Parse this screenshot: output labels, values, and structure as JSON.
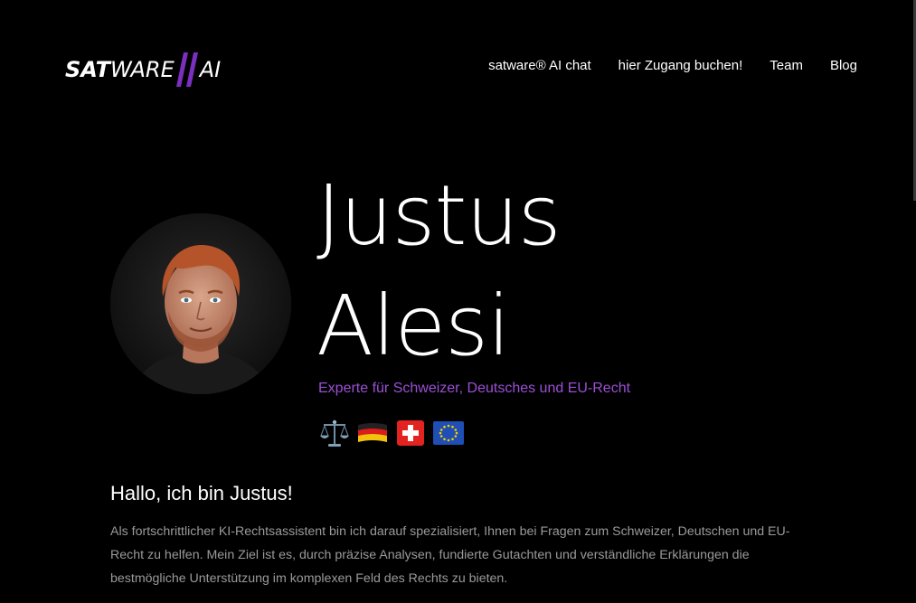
{
  "logo": {
    "part_bold": "SAT",
    "part_light": "WARE",
    "part_ai": "AI",
    "brand_color": "#7b2fbe"
  },
  "nav": {
    "items": [
      {
        "label": "satware® AI chat"
      },
      {
        "label": "hier Zugang buchen!"
      },
      {
        "label": "Team"
      },
      {
        "label": "Blog"
      }
    ]
  },
  "profile": {
    "first_name": "Justus",
    "last_name": "Alesi",
    "subtitle": "Experte für Schweizer, Deutsches und EU-Recht",
    "subtitle_color": "#9b4fd6",
    "emojis": [
      "scales-icon",
      "german-flag-icon",
      "swiss-flag-icon",
      "eu-flag-icon"
    ]
  },
  "intro": {
    "title": "Hallo, ich bin Justus!",
    "text": "Als fortschrittlicher KI-Rechtsassistent bin ich darauf spezialisiert, Ihnen bei Fragen zum Schweizer, Deutschen und EU-Recht zu helfen. Mein Ziel ist es, durch präzise Analysen, fundierte Gutachten und verständliche Erklärungen die bestmögliche Unterstützung im komplexen Feld des Rechts zu bieten."
  }
}
